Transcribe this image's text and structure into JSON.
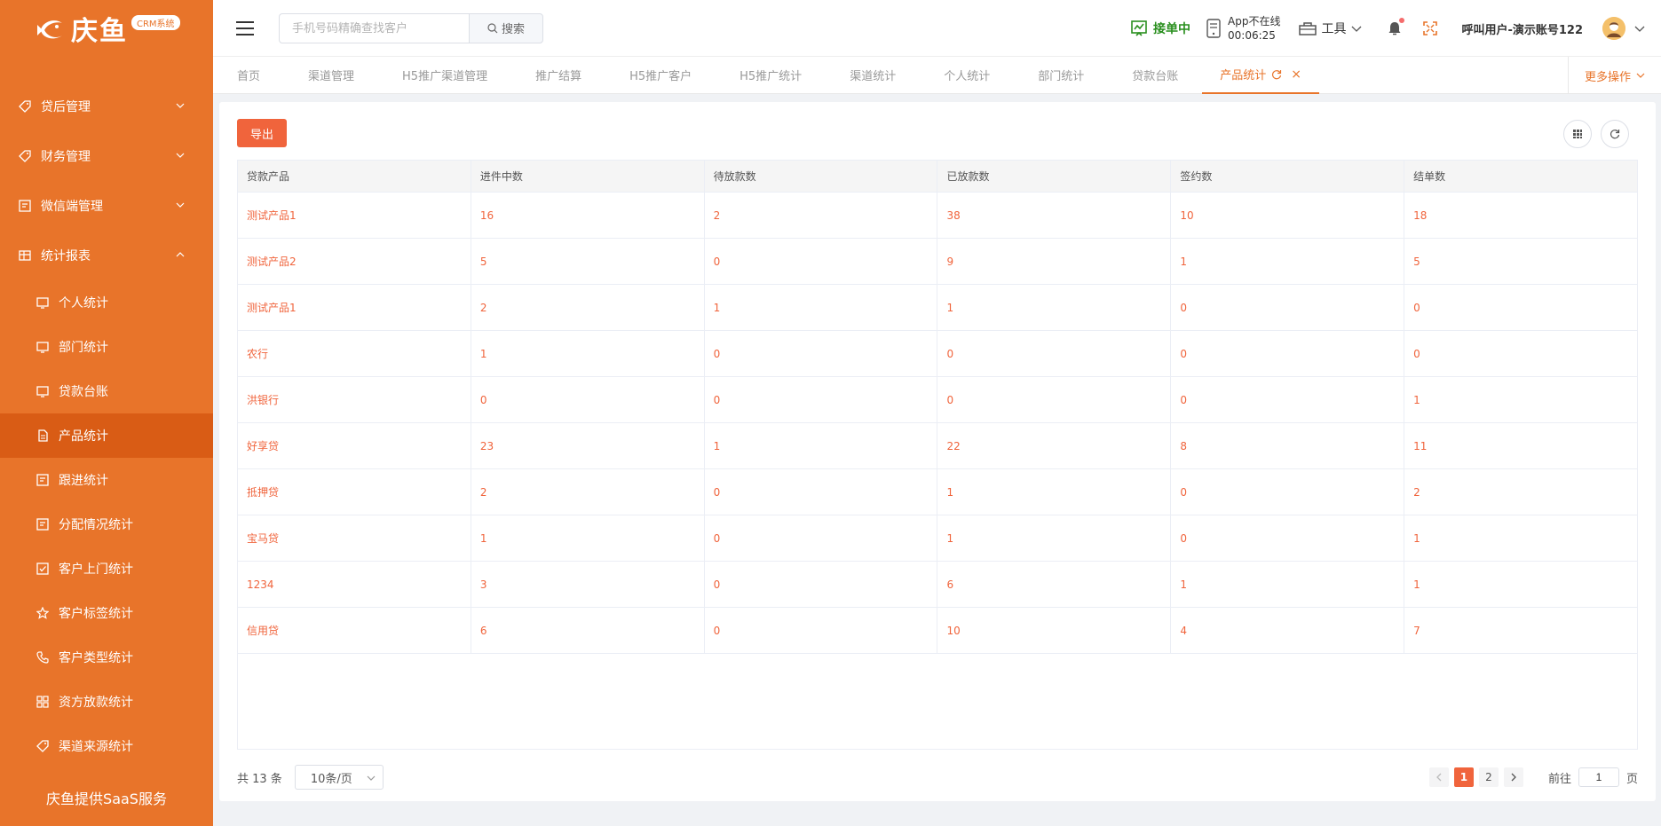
{
  "sidebar": {
    "brand": "庆鱼",
    "badge": "CRM系统",
    "menu": [
      {
        "label": "贷后管理",
        "icon": "tag-icon"
      },
      {
        "label": "财务管理",
        "icon": "tag-icon"
      },
      {
        "label": "微信端管理",
        "icon": "edit-icon"
      },
      {
        "label": "统计报表",
        "icon": "table-icon"
      }
    ],
    "sub_items": [
      {
        "label": "个人统计",
        "icon": "monitor-icon"
      },
      {
        "label": "部门统计",
        "icon": "monitor-icon"
      },
      {
        "label": "贷款台账",
        "icon": "monitor-icon"
      },
      {
        "label": "产品统计",
        "icon": "document-icon"
      },
      {
        "label": "跟进统计",
        "icon": "edit-icon"
      },
      {
        "label": "分配情况统计",
        "icon": "edit-icon"
      },
      {
        "label": "客户上门统计",
        "icon": "checkbox-icon"
      },
      {
        "label": "客户标签统计",
        "icon": "star-icon"
      },
      {
        "label": "客户类型统计",
        "icon": "phone-icon"
      },
      {
        "label": "资方放款统计",
        "icon": "grid-icon"
      },
      {
        "label": "渠道来源统计",
        "icon": "tag-icon"
      }
    ],
    "footer": "庆鱼提供SaaS服务"
  },
  "header": {
    "search_placeholder": "手机号码精确查找客户",
    "search_button": "搜索",
    "status": "接单中",
    "app_status": "App不在线",
    "app_timer": "00:06:25",
    "tools": "工具",
    "user": "呼叫用户-演示账号122"
  },
  "tabs": [
    {
      "label": "首页"
    },
    {
      "label": "渠道管理"
    },
    {
      "label": "H5推广渠道管理"
    },
    {
      "label": "推广结算"
    },
    {
      "label": "H5推广客户"
    },
    {
      "label": "H5推广统计"
    },
    {
      "label": "渠道统计"
    },
    {
      "label": "个人统计"
    },
    {
      "label": "部门统计"
    },
    {
      "label": "贷款台账"
    }
  ],
  "active_tab": "产品统计",
  "more_ops": "更多操作",
  "toolbar": {
    "export": "导出"
  },
  "table": {
    "headers": [
      "贷款产品",
      "进件中数",
      "待放款数",
      "已放款数",
      "签约数",
      "结单数"
    ],
    "rows": [
      [
        "测试产品1",
        "16",
        "2",
        "38",
        "10",
        "18"
      ],
      [
        "测试产品2",
        "5",
        "0",
        "9",
        "1",
        "5"
      ],
      [
        "测试产品1",
        "2",
        "1",
        "1",
        "0",
        "0"
      ],
      [
        "农行",
        "1",
        "0",
        "0",
        "0",
        "0"
      ],
      [
        "洪银行",
        "0",
        "0",
        "0",
        "0",
        "1"
      ],
      [
        "好享贷",
        "23",
        "1",
        "22",
        "8",
        "11"
      ],
      [
        "抵押贷",
        "2",
        "0",
        "1",
        "0",
        "2"
      ],
      [
        "宝马贷",
        "1",
        "0",
        "1",
        "0",
        "1"
      ],
      [
        "1234",
        "3",
        "0",
        "6",
        "1",
        "1"
      ],
      [
        "信用贷",
        "6",
        "0",
        "10",
        "4",
        "7"
      ]
    ]
  },
  "pagination": {
    "total": "共 13 条",
    "page_size": "10条/页",
    "pages": [
      "1",
      "2"
    ],
    "goto_prefix": "前往",
    "goto_value": "1",
    "goto_suffix": "页"
  },
  "colors": {
    "accent": "#e8742a",
    "active_sidebar": "#d95c15",
    "table_text": "#f0643c",
    "online": "#2a8f1f"
  }
}
